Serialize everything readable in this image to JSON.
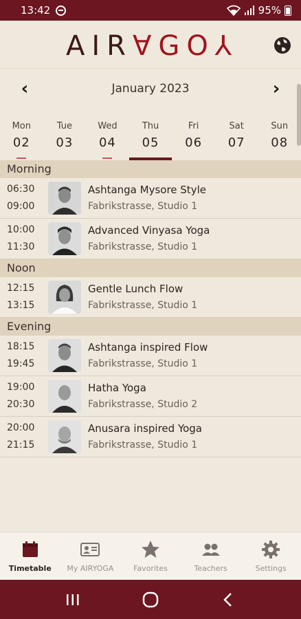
{
  "status": {
    "time": "13:42",
    "battery": "95%"
  },
  "app": {
    "logo_left": "AIR",
    "logo_right": "∀GO⅄"
  },
  "calendar": {
    "month": "January 2023",
    "days": [
      {
        "name": "Mon",
        "num": "02",
        "marked": true
      },
      {
        "name": "Tue",
        "num": "03",
        "marked": false
      },
      {
        "name": "Wed",
        "num": "04",
        "marked": true
      },
      {
        "name": "Thu",
        "num": "05",
        "marked": false,
        "active": true
      },
      {
        "name": "Fri",
        "num": "06",
        "marked": false
      },
      {
        "name": "Sat",
        "num": "07",
        "marked": false
      },
      {
        "name": "Sun",
        "num": "08",
        "marked": false
      }
    ]
  },
  "sections": [
    {
      "title": "Morning",
      "classes": [
        {
          "start": "06:30",
          "end": "09:00",
          "name": "Ashtanga Mysore Style",
          "location": "Fabrikstrasse, Studio 1"
        },
        {
          "start": "10:00",
          "end": "11:30",
          "name": "Advanced Vinyasa Yoga",
          "location": "Fabrikstrasse, Studio 1"
        }
      ]
    },
    {
      "title": "Noon",
      "classes": [
        {
          "start": "12:15",
          "end": "13:15",
          "name": "Gentle Lunch Flow",
          "location": "Fabrikstrasse, Studio 1"
        }
      ]
    },
    {
      "title": "Evening",
      "classes": [
        {
          "start": "18:15",
          "end": "19:45",
          "name": "Ashtanga inspired Flow",
          "location": "Fabrikstrasse, Studio 1"
        },
        {
          "start": "19:00",
          "end": "20:30",
          "name": "Hatha Yoga",
          "location": "Fabrikstrasse, Studio 2"
        },
        {
          "start": "20:00",
          "end": "21:15",
          "name": "Anusara inspired Yoga",
          "location": "Fabrikstrasse, Studio 1"
        }
      ]
    }
  ],
  "tabs": [
    {
      "label": "Timetable",
      "icon": "calendar-icon",
      "active": true
    },
    {
      "label": "My AIRYOGA",
      "icon": "id-card-icon"
    },
    {
      "label": "Favorites",
      "icon": "star-icon"
    },
    {
      "label": "Teachers",
      "icon": "people-icon"
    },
    {
      "label": "Settings",
      "icon": "gear-icon"
    }
  ],
  "colors": {
    "brand": "#6b1620",
    "accent": "#a0141e",
    "background": "#efe9dd",
    "section": "#e0d3bd"
  }
}
